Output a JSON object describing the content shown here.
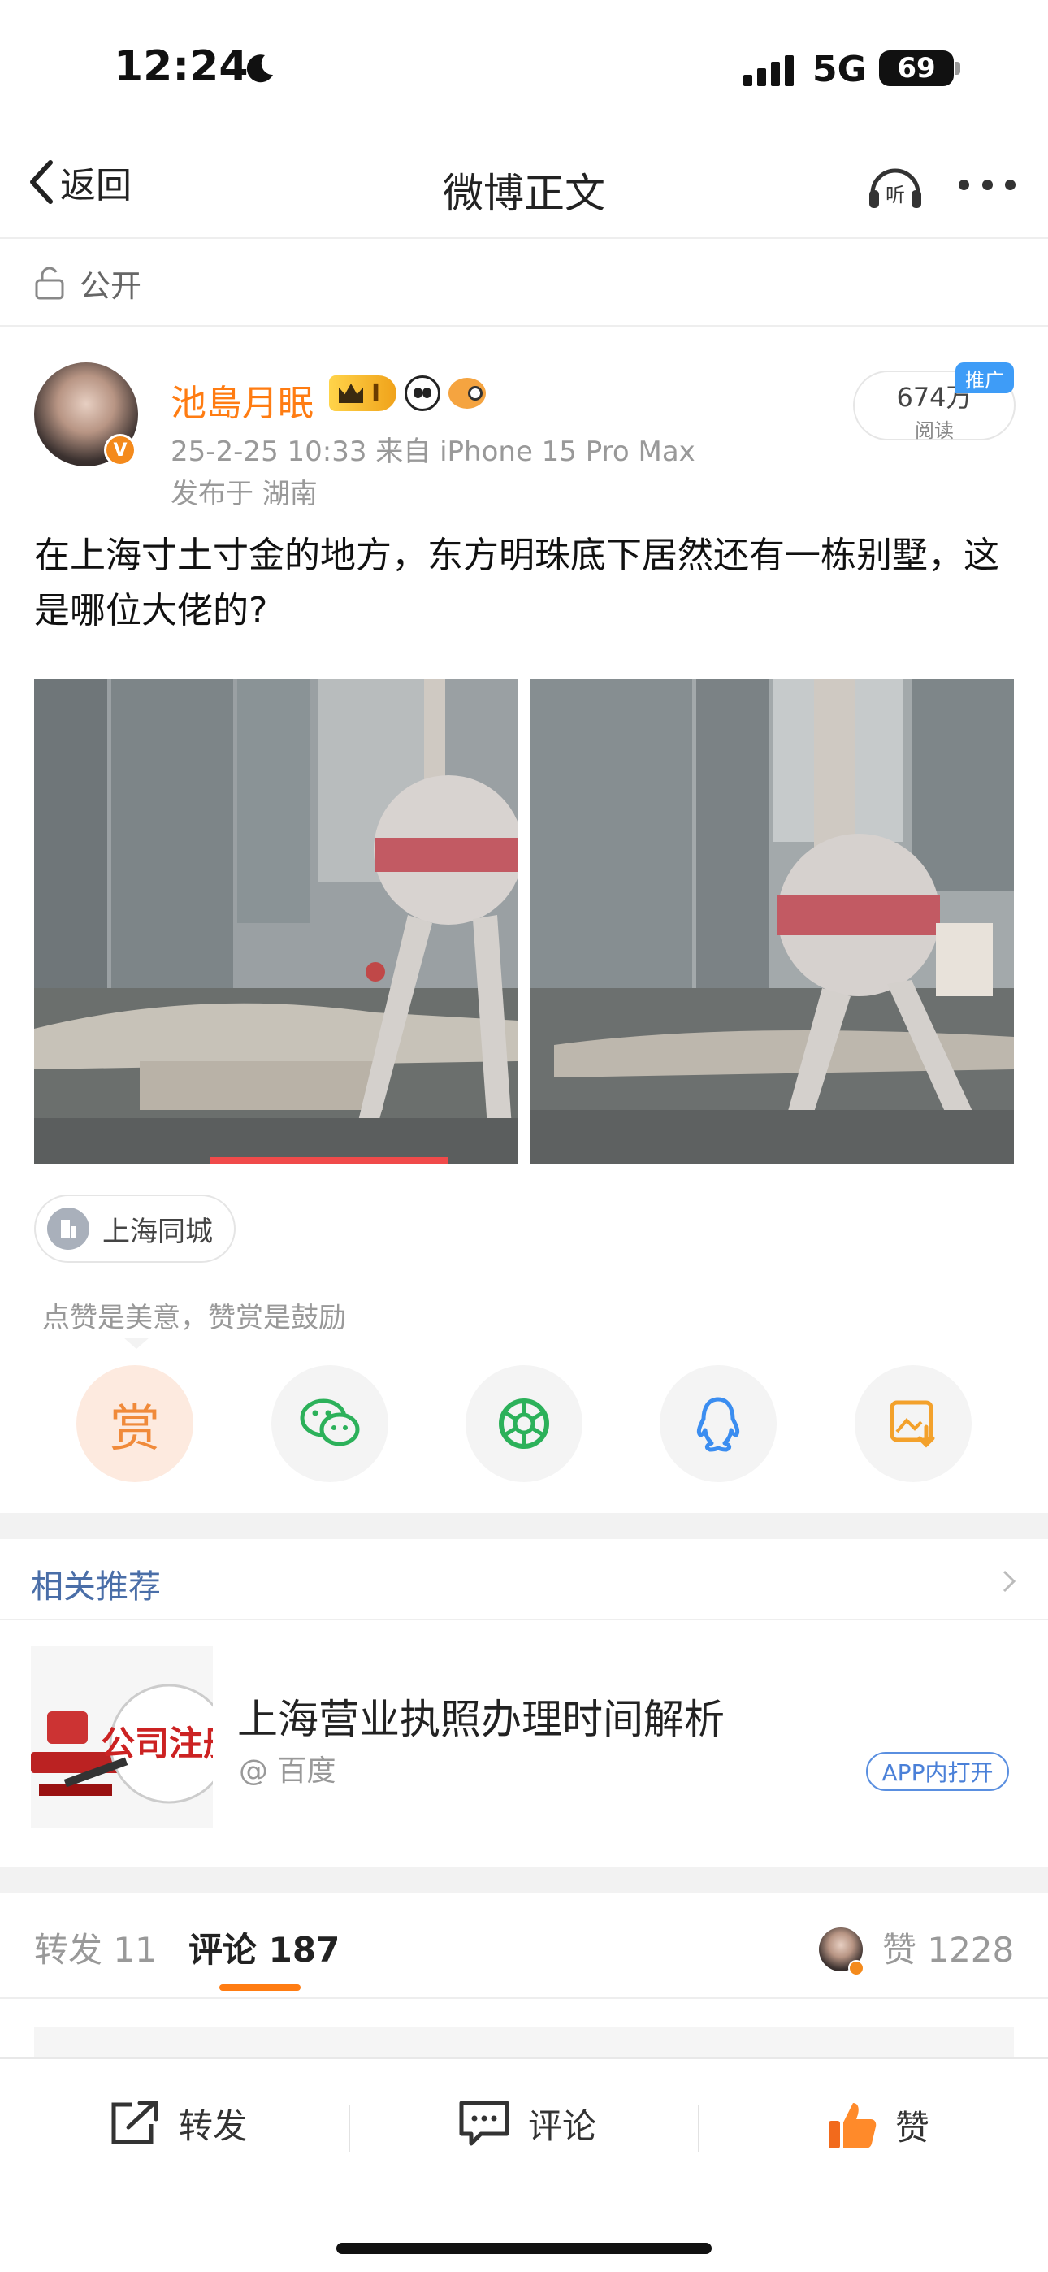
{
  "status_bar": {
    "time": "12:24",
    "network": "5G",
    "battery": "69"
  },
  "nav": {
    "back_label": "返回",
    "title": "微博正文",
    "listen_label": "听"
  },
  "privacy": {
    "label": "公开"
  },
  "post": {
    "username": "池島月眠",
    "level_badge": "I",
    "verified_mark": "V",
    "timestamp_source": "25-2-25 10:33  来自 iPhone 15 Pro Max",
    "location_line": "发布于 湖南",
    "reads_count": "674万",
    "reads_label": "阅读",
    "promo_tag": "推广",
    "text": "在上海寸土寸金的地方，东方明珠底下居然还有一栋别墅，这是哪位大佬的?",
    "location_tag": "上海同城"
  },
  "reward": {
    "tip": "点赞是美意，赞赏是鼓励",
    "reward_label": "赏",
    "share_targets": [
      "wechat-icon",
      "moments-icon",
      "qq-icon",
      "save-image-icon"
    ]
  },
  "related": {
    "title": "相关推荐",
    "item": {
      "headline": "上海营业执照办理时间解析",
      "source": "@ 百度",
      "open_label": "APP内打开",
      "thumb_text": "公司注册"
    }
  },
  "tabs": {
    "repost": "转发 11",
    "comments": "评论 187",
    "likes": "赞 1228"
  },
  "bottom_bar": {
    "repost": "转发",
    "comment": "评论",
    "like": "赞"
  },
  "colors": {
    "accent": "#ff7c12",
    "link_blue": "#4a6ea8",
    "wechat": "#2cb15a",
    "qq": "#3b8df0",
    "save": "#f3a12b"
  }
}
